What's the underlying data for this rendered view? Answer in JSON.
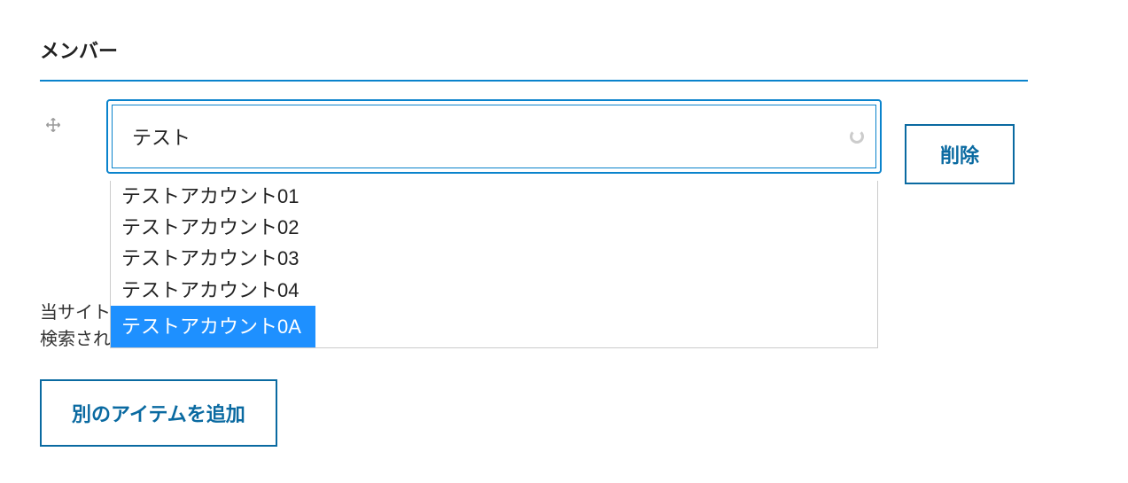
{
  "section": {
    "title": "メンバー"
  },
  "member": {
    "input_value": "テスト",
    "delete_label": "削除"
  },
  "dropdown": {
    "items": [
      {
        "label": "テストアカウント01",
        "highlighted": false
      },
      {
        "label": "テストアカウント02",
        "highlighted": false
      },
      {
        "label": "テストアカウント03",
        "highlighted": false
      },
      {
        "label": "テストアカウント04",
        "highlighted": false
      },
      {
        "label": "テストアカウント0A",
        "highlighted": true
      }
    ]
  },
  "help": {
    "line1_prefix": "当サイト",
    "line2_prefix": "検索され"
  },
  "actions": {
    "add_label": "別のアイテムを追加"
  }
}
